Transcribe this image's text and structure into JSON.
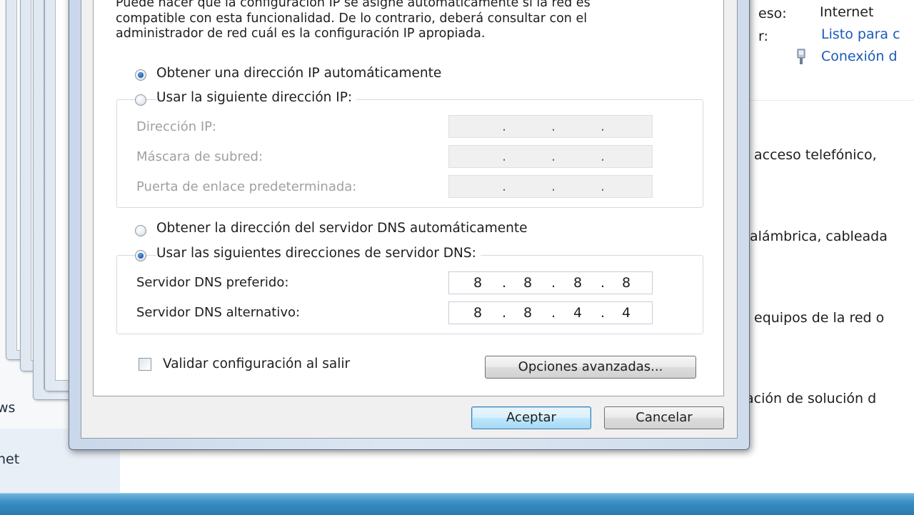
{
  "background": {
    "left_items": [
      "ws",
      "net"
    ],
    "right_rows": [
      {
        "label_fragment": "eso:",
        "value": "Internet"
      },
      {
        "label_fragment": "r:",
        "value": "Listo para c"
      }
    ],
    "connection_link": "Conexión d",
    "task_fragments": [
      "acceso telefónico,",
      "alámbrica, cableada",
      "equipos de la red o",
      "ación de solución d"
    ]
  },
  "dialog": {
    "description": "Puede hacer que la configuración IP se asigne automáticamente si la red es compatible con esta funcionalidad. De lo contrario, deberá consultar con el administrador de red cuál es la configuración IP apropiada.",
    "ip_auto_label": "Obtener una dirección IP automáticamente",
    "ip_auto_selected": true,
    "ip_manual_label": "Usar la siguiente dirección IP:",
    "ip_manual_selected": false,
    "ip_fields": {
      "ip_address_label": "Dirección IP:",
      "subnet_mask_label": "Máscara de subred:",
      "gateway_label": "Puerta de enlace predeterminada:",
      "ip_address_value": [
        "",
        "",
        "",
        ""
      ],
      "subnet_mask_value": [
        "",
        "",
        "",
        ""
      ],
      "gateway_value": [
        "",
        "",
        "",
        ""
      ]
    },
    "dns_auto_label": "Obtener la dirección del servidor DNS automáticamente",
    "dns_auto_selected": false,
    "dns_manual_label": "Usar las siguientes direcciones de servidor DNS:",
    "dns_manual_selected": true,
    "dns_fields": {
      "preferred_label": "Servidor DNS preferido:",
      "alternate_label": "Servidor DNS alternativo:",
      "preferred_value": [
        "8",
        "8",
        "8",
        "8"
      ],
      "alternate_value": [
        "8",
        "8",
        "4",
        "4"
      ]
    },
    "validate_label": "Validar configuración al salir",
    "validate_checked": false,
    "advanced_button": "Opciones avanzadas...",
    "ok_button": "Aceptar",
    "cancel_button": "Cancelar"
  },
  "colors": {
    "link": "#1a5ab8",
    "taskbar": "#3b8fc2",
    "radio_selected": "#1d5cb0",
    "default_button_border": "#3c7fb1"
  }
}
